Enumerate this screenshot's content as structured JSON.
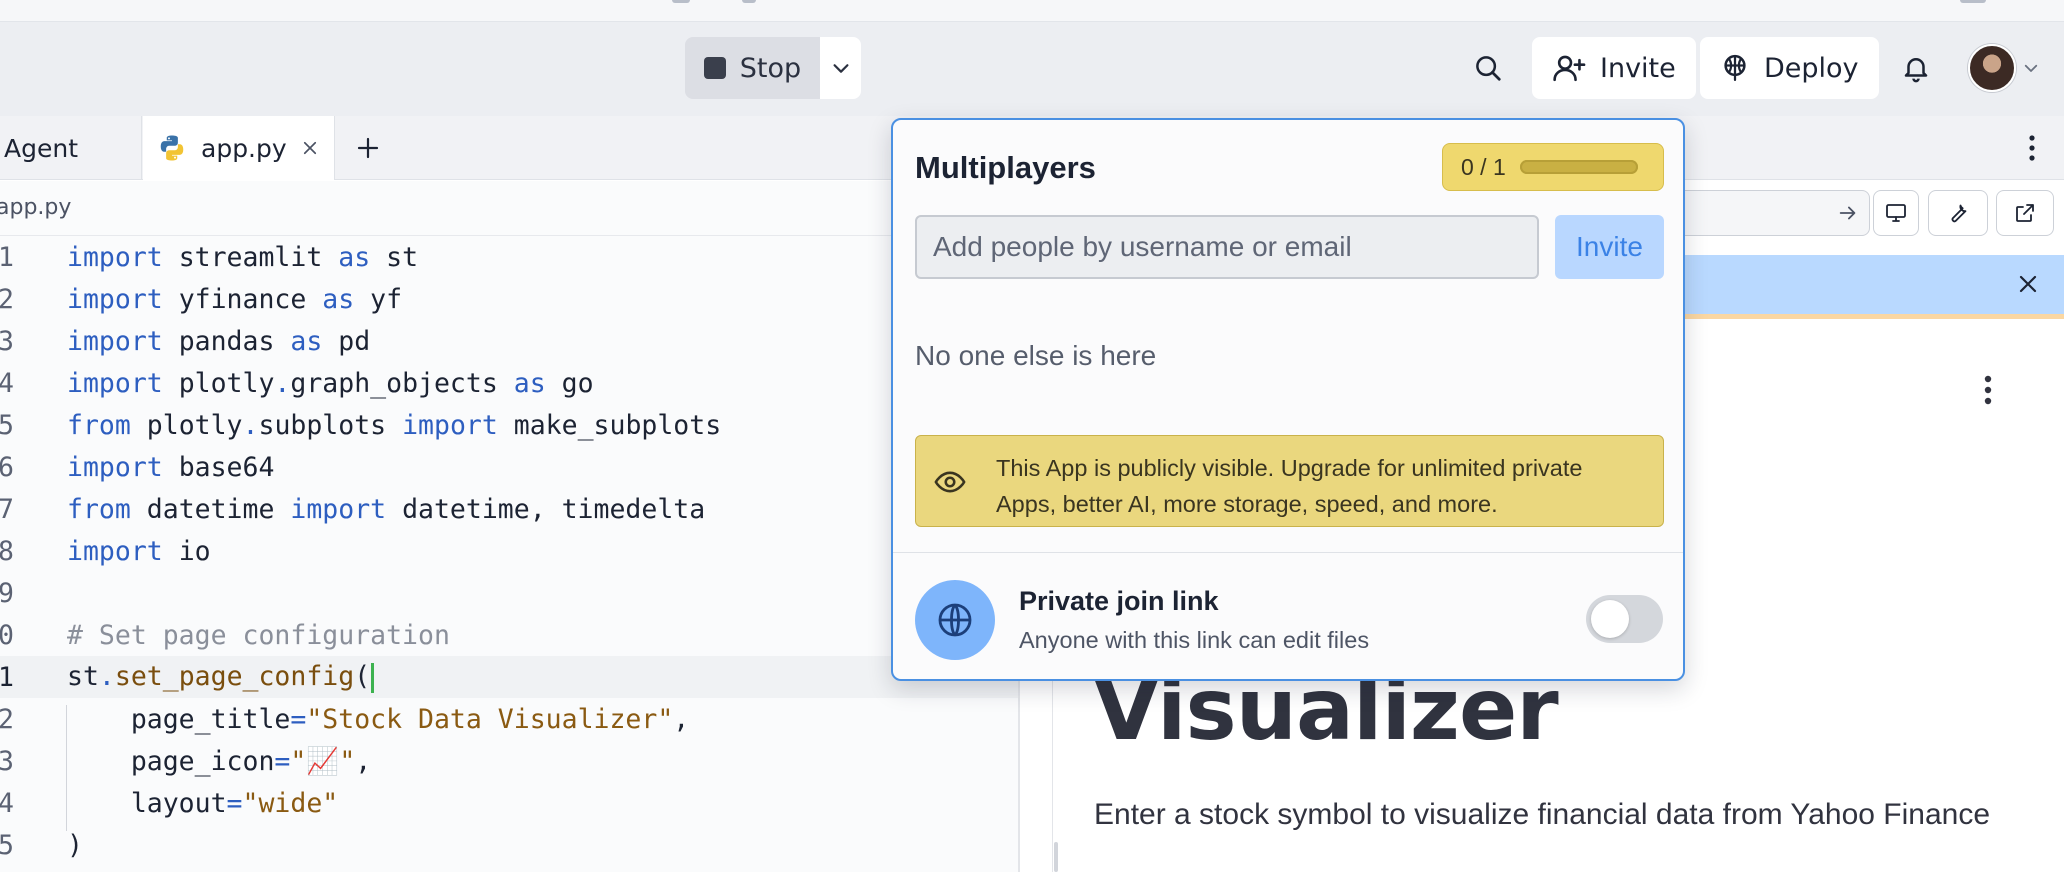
{
  "colors": {
    "accent": "#4a90e2",
    "invite_button_bg": "#b9d7ff",
    "warning_bg": "#ead77e",
    "quota_bg": "#efd86e",
    "banner_bg": "#b9d9ff",
    "cursor": "#3cb24f"
  },
  "header": {
    "stop_label": "Stop",
    "invite_label": "Invite",
    "deploy_label": "Deploy",
    "icons": [
      "search-icon",
      "add-user-icon",
      "deploy-icon",
      "bell-icon",
      "chevron-down-icon"
    ]
  },
  "tabs": [
    {
      "label": "Agent"
    },
    {
      "label": "app.py",
      "icon": "python-icon"
    }
  ],
  "editor": {
    "breadcrumb": "app.py",
    "line_numbers": [
      "1",
      "2",
      "3",
      "4",
      "5",
      "6",
      "7",
      "8",
      "9",
      "0",
      "1",
      "2",
      "3",
      "4",
      "5"
    ]
  },
  "popover": {
    "title": "Multiplayers",
    "quota": "0 / 1",
    "quota_fraction": 0,
    "search_placeholder": "Add people by username or email",
    "invite_label": "Invite",
    "empty_text": "No one else is here",
    "warning_text": "This App is publicly visible. Upgrade for unlimited private Apps, better AI, more storage, speed, and more.",
    "join_title": "Private join link",
    "join_desc": "Anyone with this link can edit files",
    "join_link_enabled": false
  },
  "preview": {
    "title": "Visualizer",
    "subtitle": "Enter a stock symbol to visualize financial data from Yahoo Finance"
  }
}
